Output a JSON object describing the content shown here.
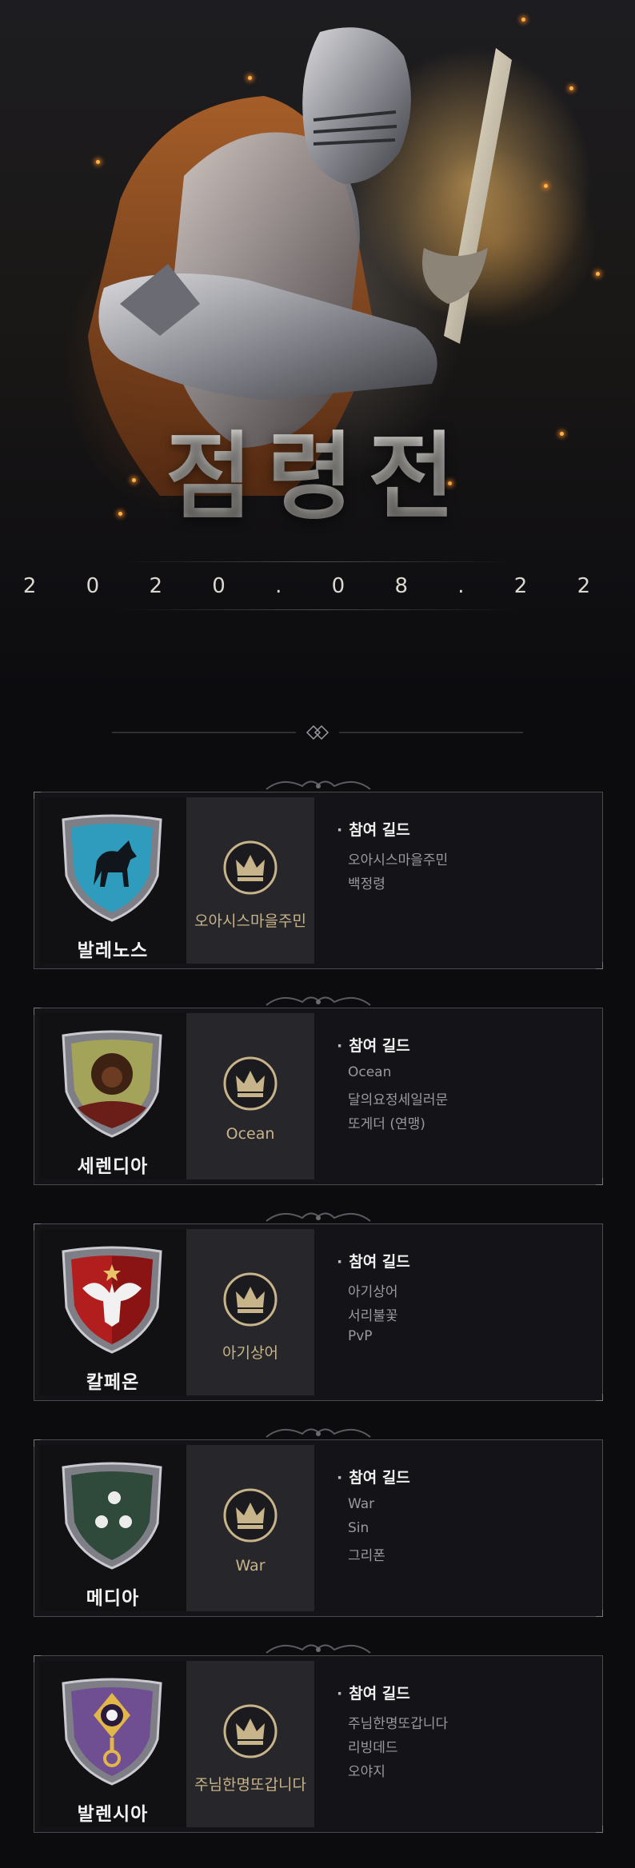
{
  "hero": {
    "title": "점령전",
    "date": "2 0 2 0 . 0 8 . 2 2"
  },
  "colors": {
    "accent_gold": "#c8b48a",
    "card_border": "#4a4a4f",
    "background": "#0c0c0f"
  },
  "regions": [
    {
      "name": "발레노스",
      "crest_icon": "blue-horse-shield-icon",
      "guild": "오아시스마을주민",
      "info_title": "참여 길드",
      "members": [
        "오아시스마을주민",
        "백정령"
      ]
    },
    {
      "name": "세렌디아",
      "crest_icon": "green-lion-shield-icon",
      "guild": "Ocean",
      "info_title": "참여 길드",
      "members": [
        "Ocean",
        "달의요정세일러문",
        "또게더 (연맹)"
      ]
    },
    {
      "name": "칼페온",
      "crest_icon": "red-eagle-shield-icon",
      "guild": "아기상어",
      "info_title": "참여 길드",
      "members": [
        "아기상어",
        "서리불꽃",
        "PvP"
      ]
    },
    {
      "name": "메디아",
      "crest_icon": "green-moon-shield-icon",
      "guild": "War",
      "info_title": "참여 길드",
      "members": [
        "War",
        "Sin",
        "그리폰"
      ]
    },
    {
      "name": "발렌시아",
      "crest_icon": "purple-eye-shield-icon",
      "guild": "주님한명또갑니다",
      "info_title": "참여 길드",
      "members": [
        "주님한명또갑니다",
        "리빙데드",
        "오야지"
      ]
    }
  ]
}
